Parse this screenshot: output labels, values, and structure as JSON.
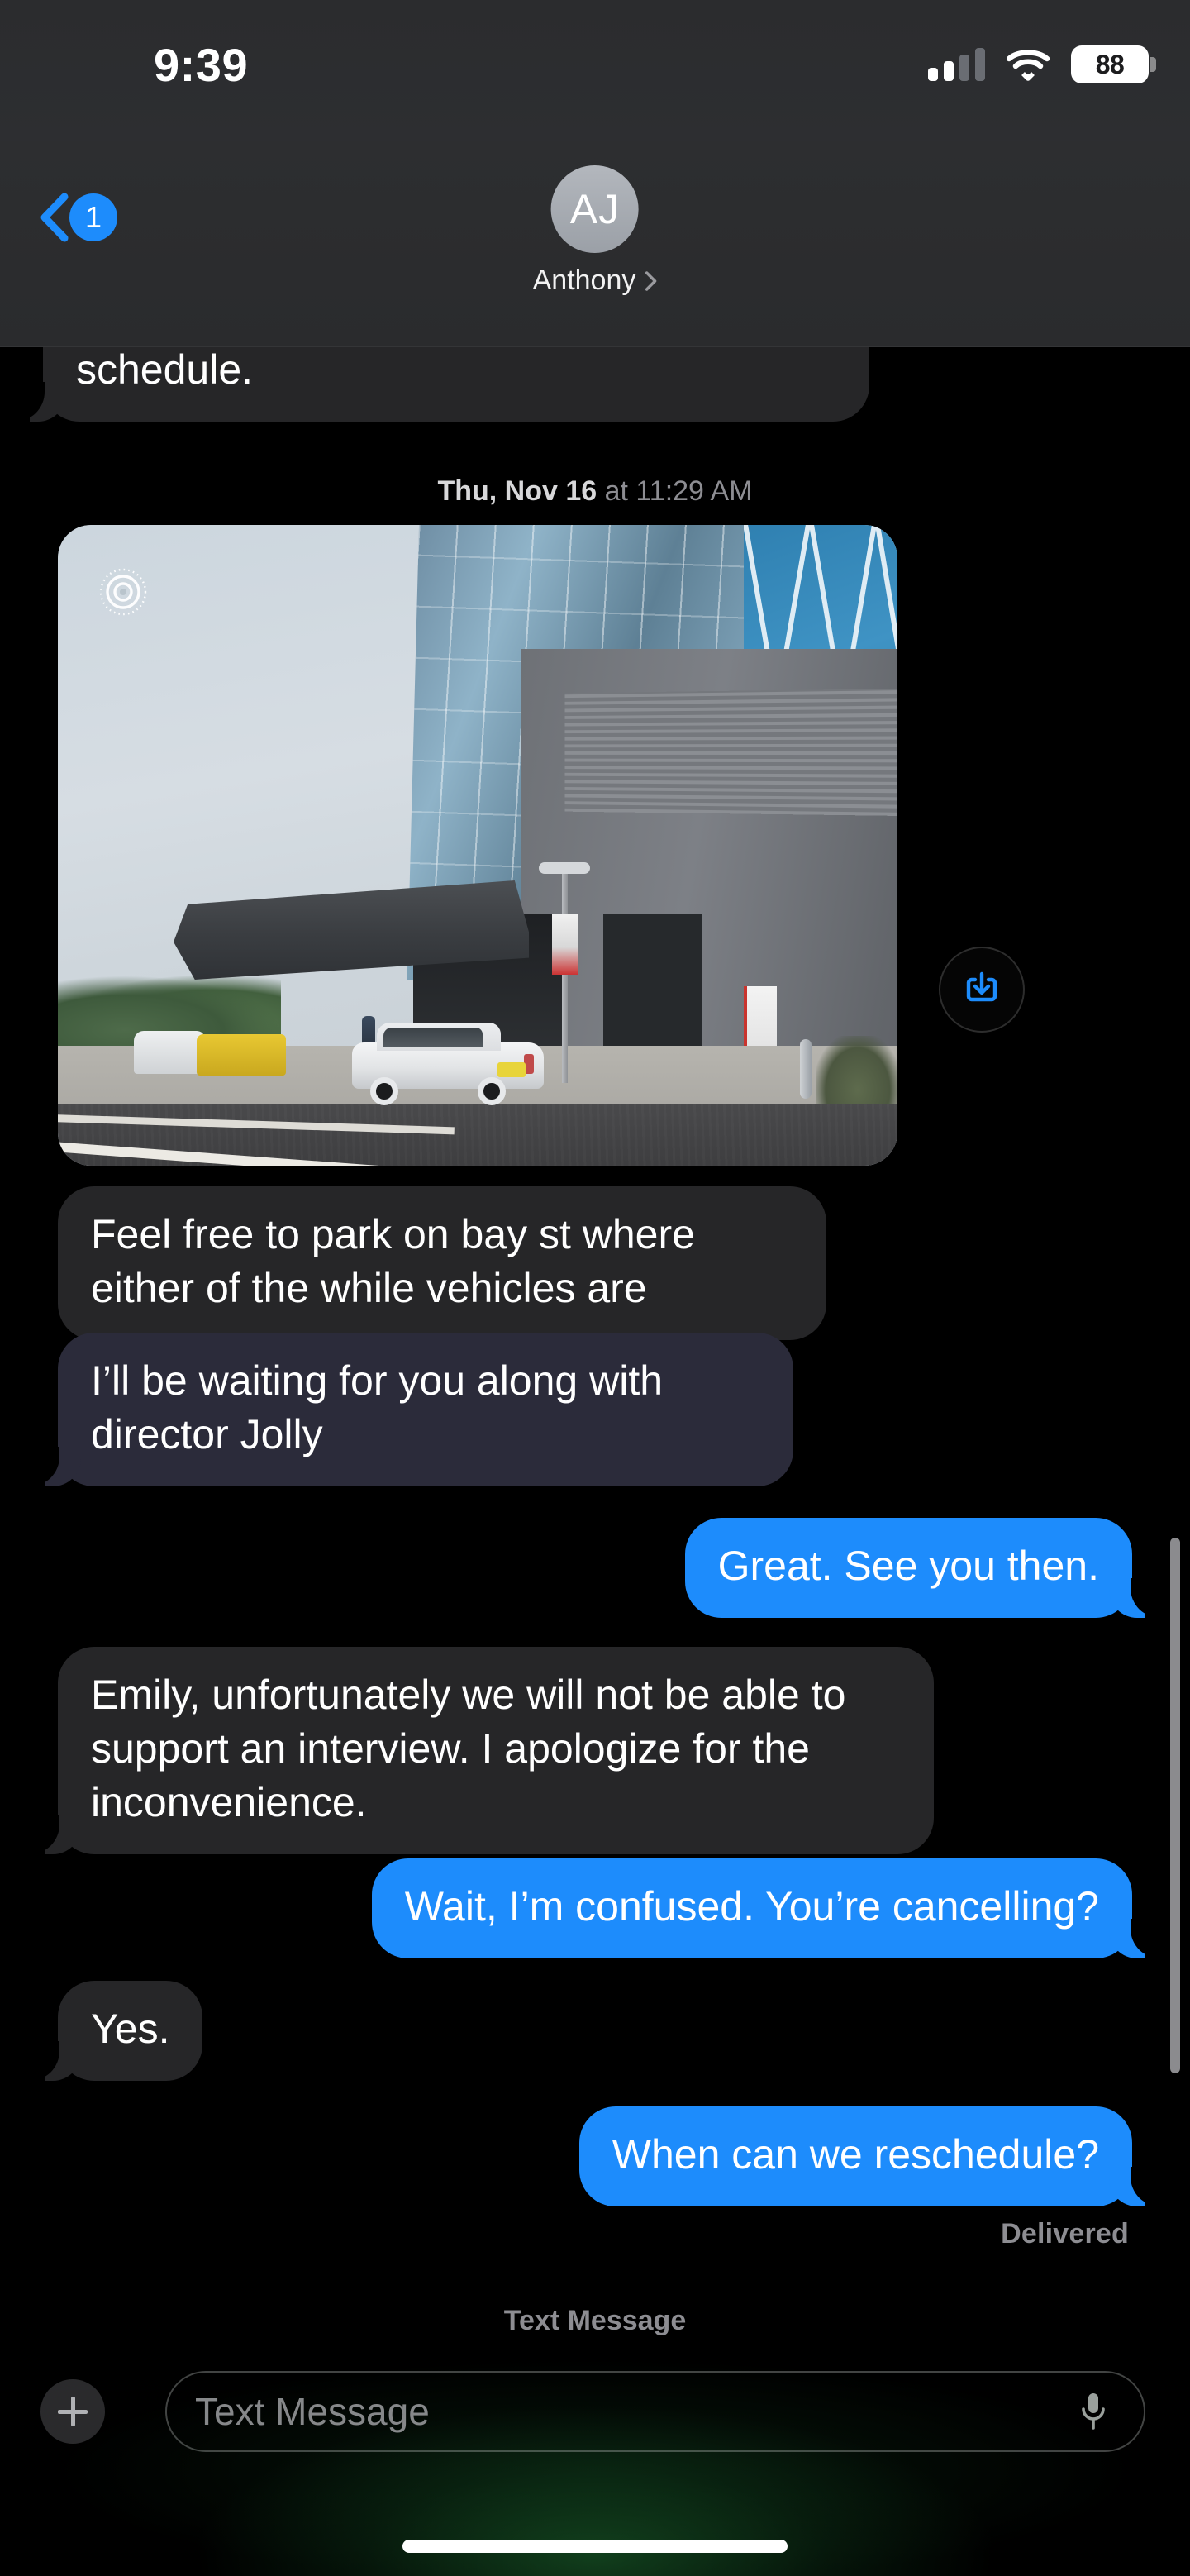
{
  "status_bar": {
    "time": "9:39",
    "battery_percent": "88",
    "signal_icon": "cellular-bars-icon",
    "wifi_icon": "wifi-icon",
    "battery_icon": "battery-icon"
  },
  "nav": {
    "back_icon": "chevron-left-icon",
    "unread_badge": "1",
    "avatar_initials": "AJ",
    "contact_name": "Anthony",
    "contact_chevron_icon": "chevron-right-icon"
  },
  "thread": {
    "partial_message": "schedule.",
    "timestamp": {
      "date": "Thu, Nov 16",
      "time": "at 11:29 AM"
    },
    "attachment": {
      "type": "photo",
      "live_photo_badge_icon": "live-photo-icon",
      "download_icon": "download-icon",
      "alt": "Photo of a modern office building with blue glass facade and a white SUV parked on the street"
    },
    "messages": [
      {
        "id": 1,
        "side": "in",
        "tint": false,
        "text": "Feel free to park on bay st where either of the while vehicles are"
      },
      {
        "id": 2,
        "side": "in",
        "tint": true,
        "text": "I’ll be waiting for you along with director Jolly"
      },
      {
        "id": 3,
        "side": "out",
        "tint": false,
        "text": "Great. See you then."
      },
      {
        "id": 4,
        "side": "in",
        "tint": false,
        "text": "Emily, unfortunately we will not be able to support an interview. I apologize for the inconvenience."
      },
      {
        "id": 5,
        "side": "out",
        "tint": false,
        "text": "Wait, I’m confused. You’re cancelling?"
      },
      {
        "id": 6,
        "side": "in",
        "tint": false,
        "text": "Yes."
      },
      {
        "id": 7,
        "side": "out",
        "tint": false,
        "text": "When can we reschedule?"
      }
    ],
    "delivery_status": "Delivered",
    "caption_label": "Text Message"
  },
  "composer": {
    "add_icon": "plus-icon",
    "input_placeholder": "Text Message",
    "input_value": "",
    "mic_icon": "microphone-icon"
  },
  "colors": {
    "accent_blue": "#1d8cfc",
    "incoming_bubble": "#262628",
    "incoming_bubble_tint": "#2b2b3a",
    "background": "#000000",
    "secondary_text": "#8d8d92"
  }
}
